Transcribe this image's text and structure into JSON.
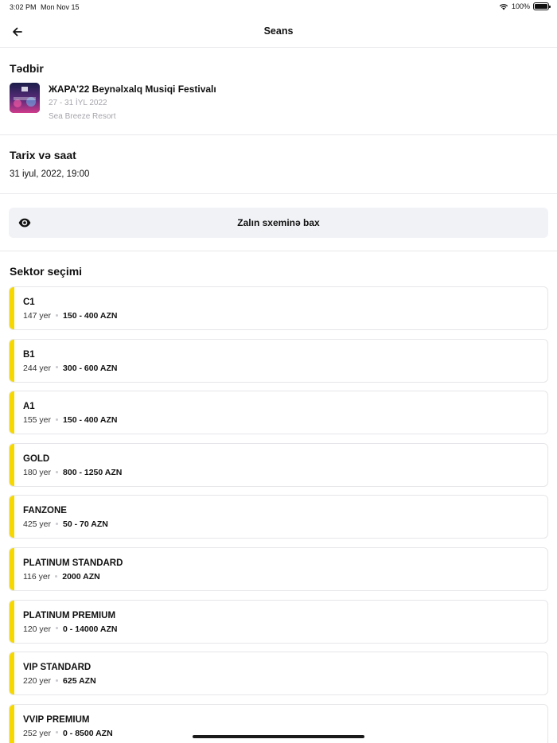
{
  "status_bar": {
    "time": "3:02 PM",
    "date": "Mon Nov 15",
    "battery": "100%"
  },
  "nav": {
    "title": "Seans",
    "back_icon": "arrow-left-icon"
  },
  "event_section": {
    "title": "Tədbir",
    "event_name": "ЖАРА'22 Beynəlxalq Musiqi Festivalı",
    "dates": "27 - 31 İYL 2022",
    "venue": "Sea Breeze Resort"
  },
  "datetime_section": {
    "title": "Tarix və saat",
    "value": "31 iyul, 2022, 19:00"
  },
  "hall_button": {
    "label": "Zalın sxeminə bax",
    "icon": "eye-icon"
  },
  "sector_section": {
    "title": "Sektor seçimi",
    "accent_color": "#f6d700",
    "items": [
      {
        "name": "C1",
        "seats": "147 yer",
        "price": "150 - 400 AZN"
      },
      {
        "name": "B1",
        "seats": "244 yer",
        "price": "300 - 600 AZN"
      },
      {
        "name": "A1",
        "seats": "155 yer",
        "price": "150 - 400 AZN"
      },
      {
        "name": "GOLD",
        "seats": "180 yer",
        "price": "800 - 1250 AZN"
      },
      {
        "name": "FANZONE",
        "seats": "425 yer",
        "price": "50 - 70 AZN"
      },
      {
        "name": "PLATINUM STANDARD",
        "seats": "116 yer",
        "price": "2000 AZN"
      },
      {
        "name": "PLATINUM PREMIUM",
        "seats": "120 yer",
        "price": "0 - 14000 AZN"
      },
      {
        "name": "VIP STANDARD",
        "seats": "220 yer",
        "price": "625 AZN"
      },
      {
        "name": "VVIP PREMIUM",
        "seats": "252 yer",
        "price": "0 - 8500 AZN"
      }
    ]
  }
}
